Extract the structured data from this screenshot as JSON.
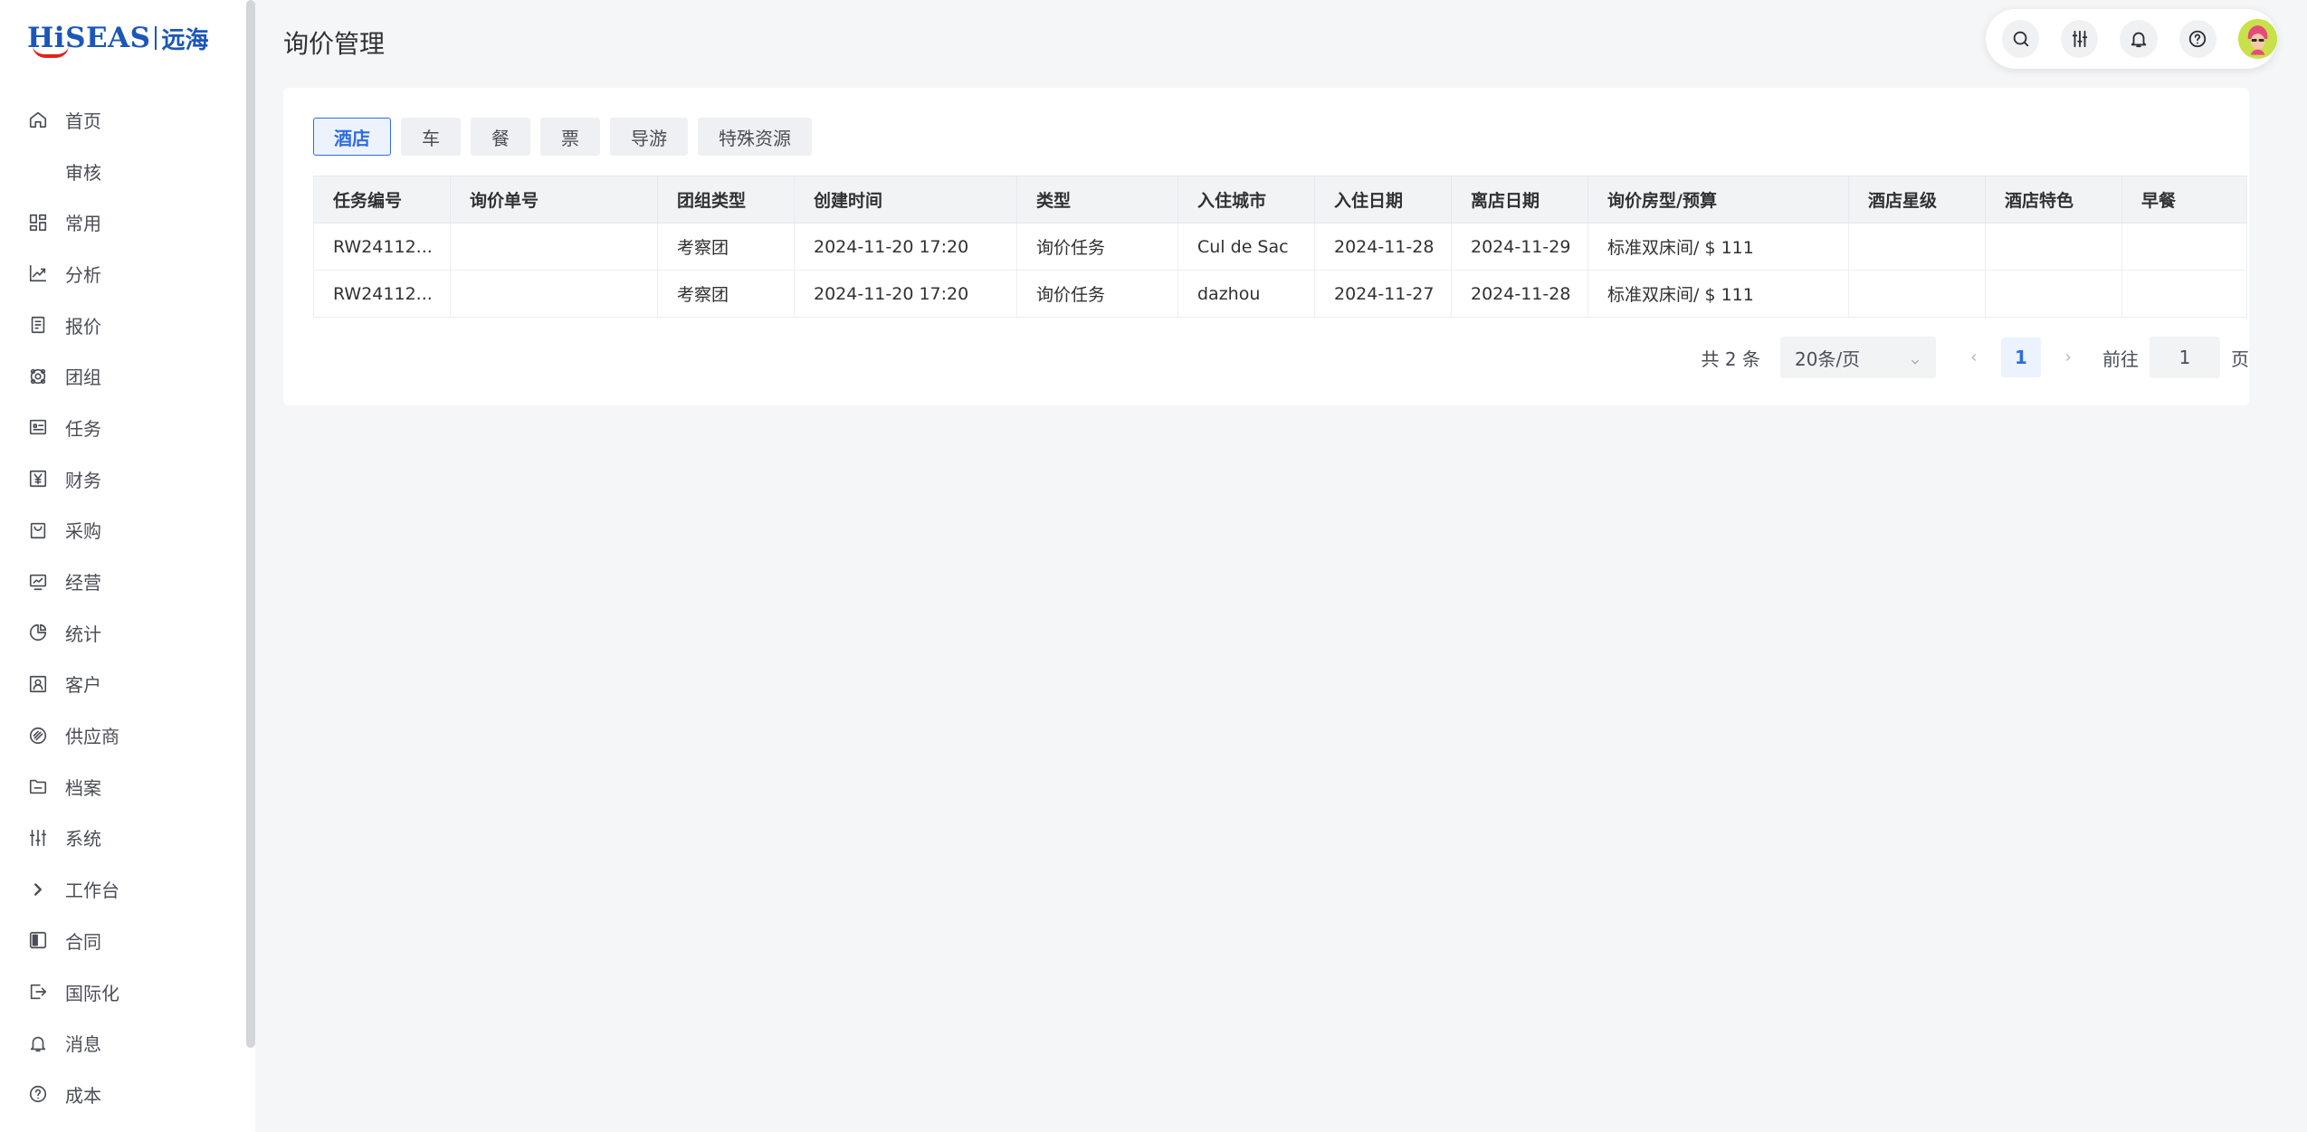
{
  "logo": {
    "main": "HiSEAS",
    "cn": "远海"
  },
  "sidebar": {
    "items": [
      {
        "label": "首页",
        "icon": "home-icon"
      },
      {
        "label": "审核",
        "icon": ""
      },
      {
        "label": "常用",
        "icon": "grid-icon"
      },
      {
        "label": "分析",
        "icon": "trend-icon"
      },
      {
        "label": "报价",
        "icon": "document-icon"
      },
      {
        "label": "团组",
        "icon": "group-icon"
      },
      {
        "label": "任务",
        "icon": "task-icon"
      },
      {
        "label": "财务",
        "icon": "yen-icon"
      },
      {
        "label": "采购",
        "icon": "bag-icon"
      },
      {
        "label": "经营",
        "icon": "monitor-icon"
      },
      {
        "label": "统计",
        "icon": "pie-icon"
      },
      {
        "label": "客户",
        "icon": "contact-icon"
      },
      {
        "label": "供应商",
        "icon": "link-icon"
      },
      {
        "label": "档案",
        "icon": "folder-icon"
      },
      {
        "label": "系统",
        "icon": "sliders-icon"
      },
      {
        "label": "工作台",
        "icon": "chevron-right-icon"
      },
      {
        "label": "合同",
        "icon": "contract-icon"
      },
      {
        "label": "国际化",
        "icon": "exit-icon"
      },
      {
        "label": "消息",
        "icon": "bell-icon"
      },
      {
        "label": "成本",
        "icon": "help-icon"
      }
    ]
  },
  "header": {
    "title": "询价管理",
    "tools": [
      "search-icon",
      "sliders-icon",
      "bell-icon",
      "help-icon"
    ]
  },
  "tabs": [
    {
      "label": "酒店",
      "active": true
    },
    {
      "label": "车",
      "active": false
    },
    {
      "label": "餐",
      "active": false
    },
    {
      "label": "票",
      "active": false
    },
    {
      "label": "导游",
      "active": false
    },
    {
      "label": "特殊资源",
      "active": false
    }
  ],
  "table": {
    "columns": [
      "任务编号",
      "询价单号",
      "团组类型",
      "创建时间",
      "类型",
      "入住城市",
      "入住日期",
      "离店日期",
      "询价房型/预算",
      "酒店星级",
      "酒店特色",
      "早餐"
    ],
    "rows": [
      [
        "RW24112...",
        "",
        "考察团",
        "2024-11-20 17:20",
        "询价任务",
        "Cul de Sac",
        "2024-11-28",
        "2024-11-29",
        "标准双床间/ $ 111",
        "",
        "",
        ""
      ],
      [
        "RW24112...",
        "",
        "考察团",
        "2024-11-20 17:20",
        "询价任务",
        "dazhou",
        "2024-11-27",
        "2024-11-28",
        "标准双床间/ $ 111",
        "",
        "",
        ""
      ]
    ]
  },
  "pagination": {
    "total": "共 2 条",
    "page_size": "20条/页",
    "current_page": "1",
    "goto_label": "前往",
    "goto_value": "1",
    "goto_unit": "页"
  },
  "colors": {
    "accent": "#2e6be6",
    "brand": "#1b57b8",
    "logo_arc": "#e2231a"
  }
}
